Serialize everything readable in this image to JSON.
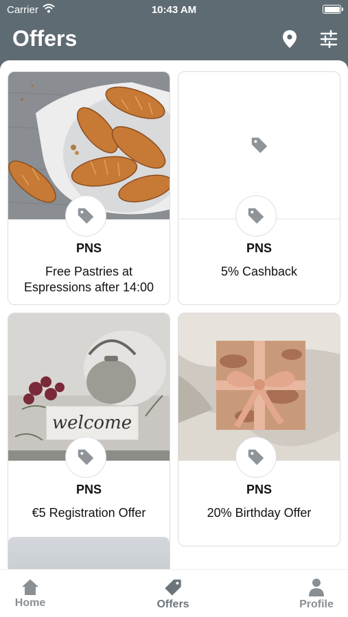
{
  "status_bar": {
    "carrier": "Carrier",
    "time": "10:43 AM"
  },
  "header": {
    "title": "Offers",
    "icons": [
      "location-pin-icon",
      "filter-sliders-icon"
    ]
  },
  "offers": [
    {
      "brand": "PNS",
      "description": "Free Pastries at Espressions after 14:00",
      "image": "croissants-photo"
    },
    {
      "brand": "PNS",
      "description": "5% Cashback",
      "image": "placeholder-tag-icon"
    },
    {
      "brand": "PNS",
      "description": "€5 Registration Offer",
      "image": "welcome-sign-photo"
    },
    {
      "brand": "PNS",
      "description": "20% Birthday Offer",
      "image": "gift-box-photo"
    }
  ],
  "tabs": [
    {
      "label": "Home",
      "icon": "house-icon",
      "active": false
    },
    {
      "label": "Offers",
      "icon": "tag-icon",
      "active": true
    },
    {
      "label": "Profile",
      "icon": "person-icon",
      "active": false
    }
  ],
  "colors": {
    "header_bg": "#5f6b73",
    "tab_active": "#6b757b",
    "tab_inactive": "#8a8f93",
    "tag_icon": "#8f9499"
  }
}
